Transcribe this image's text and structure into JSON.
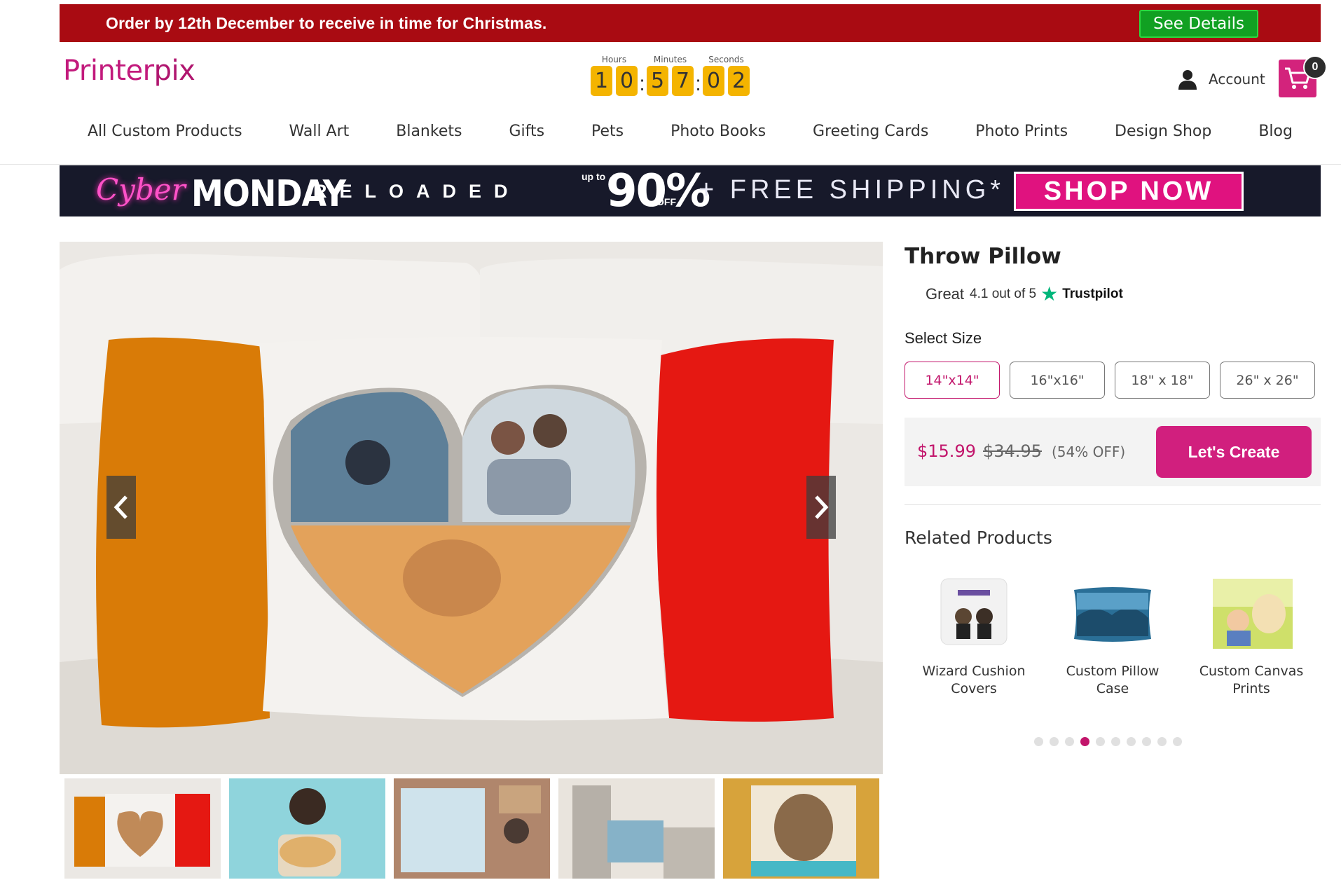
{
  "promo": {
    "text": "Order by 12th December to receive in time for Christmas.",
    "button": "See Details"
  },
  "header": {
    "logo": {
      "part1": "Printer",
      "part2": "pix"
    },
    "countdown": {
      "labels": {
        "hours": "Hours",
        "minutes": "Minutes",
        "seconds": "Seconds"
      },
      "digits": [
        "1",
        "0",
        "5",
        "7",
        "0",
        "2"
      ]
    },
    "account_label": "Account",
    "cart_count": "0"
  },
  "nav": [
    "All Custom Products",
    "Wall Art",
    "Blankets",
    "Gifts",
    "Pets",
    "Photo Books",
    "Greeting Cards",
    "Photo Prints",
    "Design Shop",
    "Blog"
  ],
  "banner": {
    "cyber": "Cyber",
    "monday": "MONDAY",
    "reloaded": "RELOADED",
    "upto": "up to",
    "percent": "90%",
    "off": "OFF",
    "free_shipping": "+ FREE SHIPPING*",
    "shop_now": "SHOP NOW"
  },
  "product": {
    "title": "Throw Pillow",
    "rating": {
      "label": "Great",
      "score": "4.1 out of 5",
      "brand": "Trustpilot"
    },
    "select_size_label": "Select Size",
    "sizes": [
      "14\"x14\"",
      "16\"x16\"",
      "18\" x 18\"",
      "26\" x 26\""
    ],
    "selected_size_index": 0,
    "price": "$15.99",
    "old_price": "$34.95",
    "discount": "(54% OFF)",
    "cta": "Let's Create"
  },
  "related": {
    "title": "Related Products",
    "items": [
      {
        "label_line1": "Wizard Cushion",
        "label_line2": "Covers"
      },
      {
        "label_line1": "Custom Pillow",
        "label_line2": "Case"
      },
      {
        "label_line1": "Custom Canvas",
        "label_line2": "Prints"
      }
    ],
    "dots_total": 10,
    "dots_active": 3
  },
  "colors": {
    "brand": "#c2156b",
    "promo_red": "#a90b12",
    "see_details_green": "#11a022",
    "countdown_yellow": "#f4b400"
  }
}
